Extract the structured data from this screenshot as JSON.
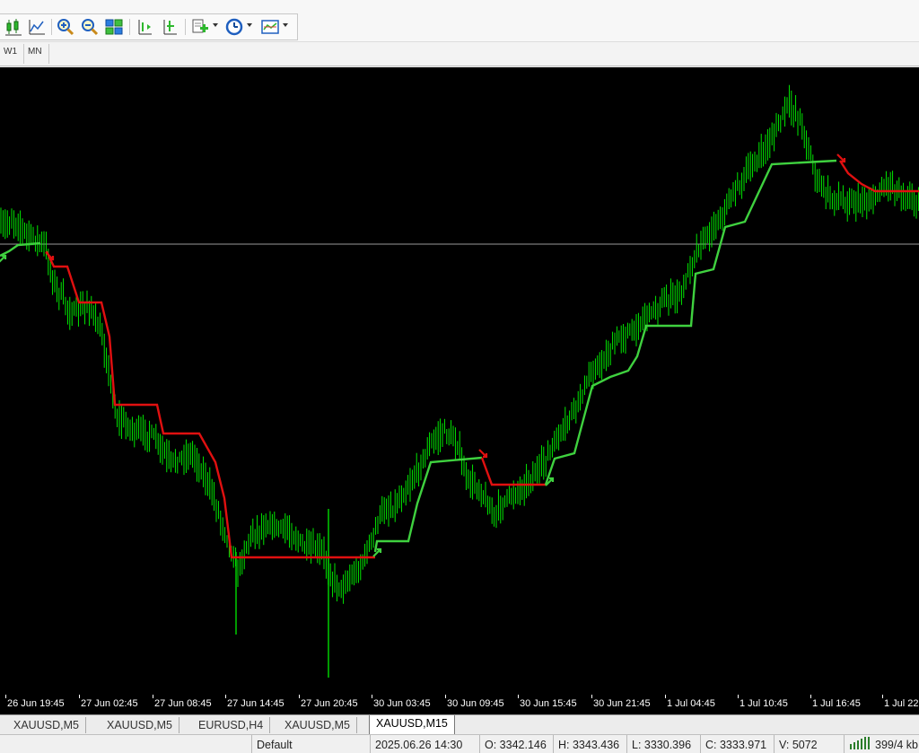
{
  "toolbar": {
    "buttons": [
      {
        "name": "candlesticks-icon"
      },
      {
        "name": "line-chart-icon"
      },
      {
        "name": "zoom-in-icon"
      },
      {
        "name": "zoom-out-icon"
      },
      {
        "name": "tile-windows-icon"
      },
      {
        "name": "chart-shift-icon"
      },
      {
        "name": "auto-scroll-icon"
      },
      {
        "name": "indicators-icon"
      },
      {
        "name": "periods-icon"
      },
      {
        "name": "templates-icon"
      }
    ]
  },
  "timeframes": [
    "W1",
    "MN"
  ],
  "chart": {
    "background": "#000000",
    "candle_color": "#00ff00",
    "trend_up_color": "#3fd13f",
    "trend_down_color": "#e01010",
    "grid": false
  },
  "x_axis_labels": [
    "26 Jun 19:45",
    "27 Jun 02:45",
    "27 Jun 08:45",
    "27 Jun 14:45",
    "27 Jun 20:45",
    "30 Jun 03:45",
    "30 Jun 09:45",
    "30 Jun 15:45",
    "30 Jun 21:45",
    "1 Jul 04:45",
    "1 Jul 10:45",
    "1 Jul 16:45",
    "1 Jul 22:"
  ],
  "tabs": [
    {
      "label": "XAUUSD,M5",
      "active": false
    },
    {
      "label": "XAUUSD,M5",
      "active": false
    },
    {
      "label": "EURUSD,H4",
      "active": false
    },
    {
      "label": "XAUUSD,M5",
      "active": false
    },
    {
      "label": "XAUUSD,M15",
      "active": true
    }
  ],
  "status": {
    "profile": "Default",
    "datetime": "2025.06.26 14:30",
    "open": "O: 3342.146",
    "high": "H: 3343.436",
    "low": "L: 3330.396",
    "close": "C: 3333.971",
    "volume": "V: 5072",
    "traffic": "399/4 kb"
  }
}
